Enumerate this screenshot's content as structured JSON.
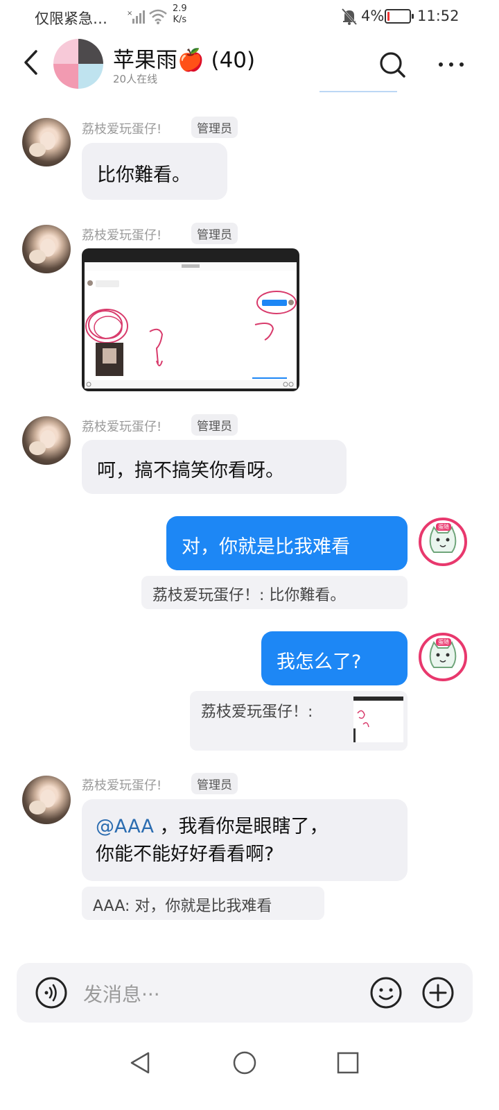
{
  "status_bar": {
    "carrier": "仅限紧急…",
    "speed_value": "2.9",
    "speed_unit": "K/s",
    "battery": "4%",
    "time": "11:52"
  },
  "header": {
    "group_name": "苹果雨🍎",
    "member_count": "(40)",
    "online": "20人在线"
  },
  "messages": [
    {
      "sender": "荔枝爱玩蛋仔!",
      "badge": "管理员",
      "text": "比你難看。"
    },
    {
      "sender": "荔枝爱玩蛋仔!",
      "badge": "管理员",
      "image": "screenshot-with-drawings"
    },
    {
      "sender": "荔枝爱玩蛋仔!",
      "badge": "管理员",
      "text": "呵，搞不搞笑你看呀。"
    },
    {
      "self": true,
      "text": "对，你就是比我难看",
      "quote": "荔枝爱玩蛋仔！: 比你難看。"
    },
    {
      "self": true,
      "text": "我怎么了?",
      "quote": "荔枝爱玩蛋仔！:"
    },
    {
      "sender": "荔枝爱玩蛋仔!",
      "badge": "管理员",
      "mention": "@AAA",
      "text_line1": " ，我看你是眼瞎了，",
      "text_line2": "你能不能好好看看啊?",
      "quote": "AAA: 对，你就是比我难看"
    }
  ],
  "self_avatar_tag": "蛋随",
  "input": {
    "placeholder": "发消息···"
  },
  "colors": {
    "self_bubble": "#1d87f5",
    "incoming_bubble": "#f0f0f4",
    "avatar_ring": "#e8386d"
  }
}
